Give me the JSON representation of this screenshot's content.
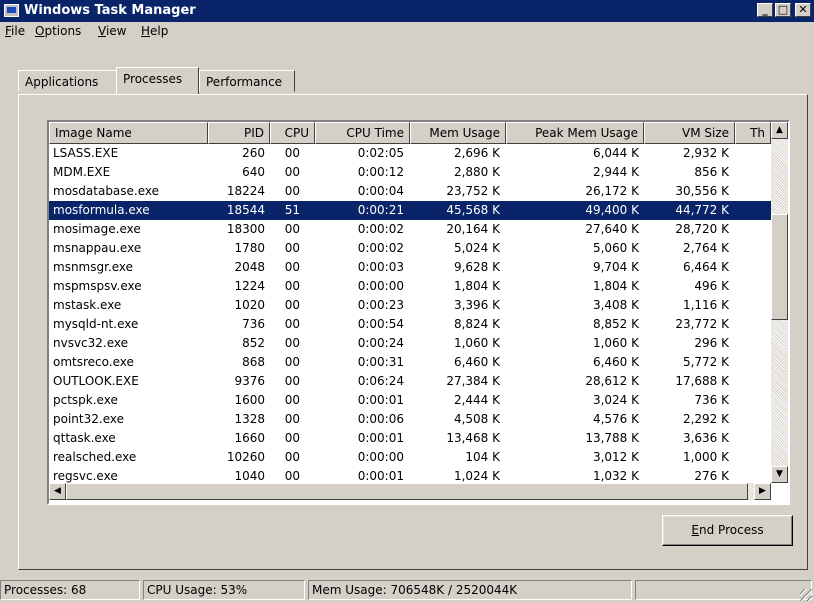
{
  "window": {
    "title": "Windows Task Manager",
    "btn_min": "_",
    "btn_max": "□",
    "btn_close": "✕"
  },
  "menu": [
    {
      "label": "File",
      "accel": "F",
      "rest": "ile"
    },
    {
      "label": "Options",
      "accel": "O",
      "rest": "ptions"
    },
    {
      "label": "View",
      "accel": "V",
      "rest": "iew"
    },
    {
      "label": "Help",
      "accel": "H",
      "rest": "elp"
    }
  ],
  "tabs": [
    {
      "label": "Applications",
      "active": false
    },
    {
      "label": "Processes",
      "active": true
    },
    {
      "label": "Performance",
      "active": false
    }
  ],
  "columns": [
    "Image Name",
    "PID",
    "CPU",
    "CPU Time",
    "Mem Usage",
    "Peak Mem Usage",
    "VM Size",
    "Th"
  ],
  "rows": [
    [
      "LSASS.EXE",
      "260",
      "00",
      "0:02:05",
      "2,696 K",
      "6,044 K",
      "2,932 K"
    ],
    [
      "MDM.EXE",
      "640",
      "00",
      "0:00:12",
      "2,880 K",
      "2,944 K",
      "856 K"
    ],
    [
      "mosdatabase.exe",
      "18224",
      "00",
      "0:00:04",
      "23,752 K",
      "26,172 K",
      "30,556 K"
    ],
    [
      "mosformula.exe",
      "18544",
      "51",
      "0:00:21",
      "45,568 K",
      "49,400 K",
      "44,772 K"
    ],
    [
      "mosimage.exe",
      "18300",
      "00",
      "0:00:02",
      "20,164 K",
      "27,640 K",
      "28,720 K"
    ],
    [
      "msnappau.exe",
      "1780",
      "00",
      "0:00:02",
      "5,024 K",
      "5,060 K",
      "2,764 K"
    ],
    [
      "msnmsgr.exe",
      "2048",
      "00",
      "0:00:03",
      "9,628 K",
      "9,704 K",
      "6,464 K"
    ],
    [
      "mspmspsv.exe",
      "1224",
      "00",
      "0:00:00",
      "1,804 K",
      "1,804 K",
      "496 K"
    ],
    [
      "mstask.exe",
      "1020",
      "00",
      "0:00:23",
      "3,396 K",
      "3,408 K",
      "1,116 K"
    ],
    [
      "mysqld-nt.exe",
      "736",
      "00",
      "0:00:54",
      "8,824 K",
      "8,852 K",
      "23,772 K"
    ],
    [
      "nvsvc32.exe",
      "852",
      "00",
      "0:00:24",
      "1,060 K",
      "1,060 K",
      "296 K"
    ],
    [
      "omtsreco.exe",
      "868",
      "00",
      "0:00:31",
      "6,460 K",
      "6,460 K",
      "5,772 K"
    ],
    [
      "OUTLOOK.EXE",
      "9376",
      "00",
      "0:06:24",
      "27,384 K",
      "28,612 K",
      "17,688 K"
    ],
    [
      "pctspk.exe",
      "1600",
      "00",
      "0:00:01",
      "2,444 K",
      "3,024 K",
      "736 K"
    ],
    [
      "point32.exe",
      "1328",
      "00",
      "0:00:06",
      "4,508 K",
      "4,576 K",
      "2,292 K"
    ],
    [
      "qttask.exe",
      "1660",
      "00",
      "0:00:01",
      "13,468 K",
      "13,788 K",
      "3,636 K"
    ],
    [
      "realsched.exe",
      "10260",
      "00",
      "0:00:00",
      "104 K",
      "3,012 K",
      "1,000 K"
    ],
    [
      "regsvc.exe",
      "1040",
      "00",
      "0:00:01",
      "1,024 K",
      "1,032 K",
      "276 K"
    ]
  ],
  "selected_row": "mosformula.exe",
  "buttons": {
    "end_process": "End Process",
    "end_process_accel": "E",
    "end_process_rest": "nd Process"
  },
  "status": {
    "processes": "Processes: 68",
    "cpu": "CPU Usage: 53%",
    "mem": "Mem Usage: 706548K / 2520044K"
  },
  "colors": {
    "titlebar": "#0a246a",
    "selection": "#0a246a",
    "face": "#d4d0c8"
  }
}
